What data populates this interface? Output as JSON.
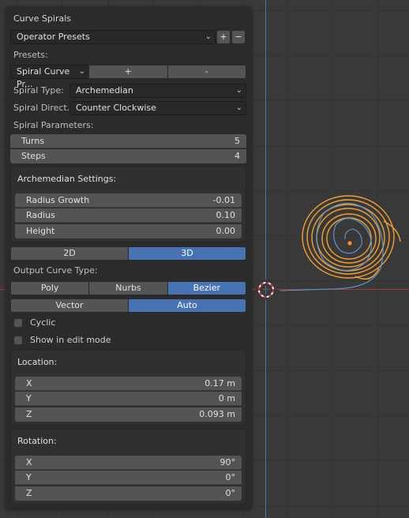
{
  "panel": {
    "title": "Curve Spirals",
    "operator_presets": "Operator Presets",
    "presets_label": "Presets:",
    "preset_value": "Spiral Curve Pr...",
    "preset_add": "+",
    "preset_remove": "-",
    "add_symbol": "+",
    "remove_symbol": "−",
    "spiral_type_label": "Spiral Type:",
    "spiral_type_value": "Archemedian",
    "spiral_direction_label": "Spiral Direct...",
    "spiral_direction_value": "Counter Clockwise",
    "spiral_params_label": "Spiral Parameters:",
    "turns_label": "Turns",
    "turns_value": "5",
    "steps_label": "Steps",
    "steps_value": "4",
    "arch_title": "Archemedian Settings:",
    "radius_growth_label": "Radius Growth",
    "radius_growth_value": "-0.01",
    "radius_label": "Radius",
    "radius_value": "0.10",
    "height_label": "Height",
    "height_value": "0.00",
    "dim_2d": "2D",
    "dim_3d": "3D",
    "output_curve_label": "Output Curve Type:",
    "curve_poly": "Poly",
    "curve_nurbs": "Nurbs",
    "curve_bezier": "Bezier",
    "handle_vector": "Vector",
    "handle_auto": "Auto",
    "cyclic_label": "Cyclic",
    "show_edit_label": "Show in edit mode",
    "location_title": "Location:",
    "loc_x_label": "X",
    "loc_x_value": "0.17 m",
    "loc_y_label": "Y",
    "loc_y_value": "0 m",
    "loc_z_label": "Z",
    "loc_z_value": "0.093 m",
    "rotation_title": "Rotation:",
    "rot_x_label": "X",
    "rot_x_value": "90°",
    "rot_y_label": "Y",
    "rot_y_value": "0°",
    "rot_z_label": "Z",
    "rot_z_value": "0°"
  },
  "colors": {
    "accent": "#4772b3",
    "spiral_selected": "#f5a031",
    "spiral_other": "#5e9bd6",
    "axis_x": "#9a3d3d",
    "axis_y": "#4a72a8"
  }
}
